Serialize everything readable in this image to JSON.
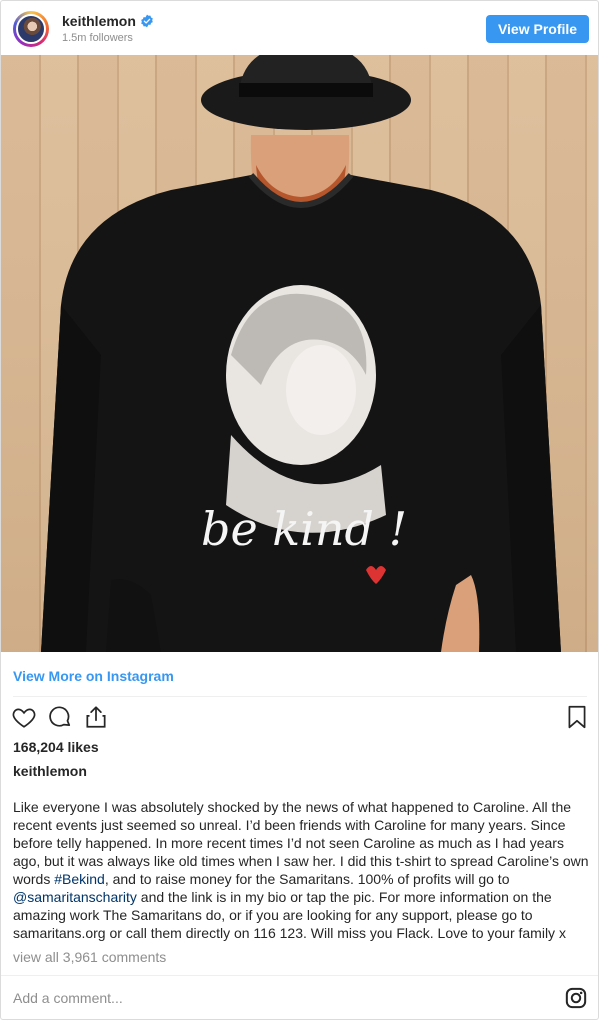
{
  "header": {
    "username": "keithlemon",
    "followers": "1.5m followers",
    "view_profile": "View Profile"
  },
  "post": {
    "image_text": "be kind !",
    "view_more": "View More on Instagram",
    "likes": "168,204 likes",
    "caption_user": "keithlemon",
    "caption_part1": "Like everyone I was absolutely shocked by the news of what happened to Caroline. All the recent events just seemed so unreal. I’d been friends with Caroline for many years. Since before telly happened. In more recent times I’d not seen Caroline as much as I had years ago, but it was always like old times when I saw her. I did this t-shirt to spread Caroline’s own words ",
    "hashtag": "#Bekind",
    "caption_part2": ", and to raise money for the Samaritans. 100% of profits will go to ",
    "mention": "@samaritanscharity",
    "caption_part3": " and the link is in my bio or tap the pic. For more information on the amazing work The Samaritans do, or if you are looking for any support, please go to samaritans.org or call them directly on 116 123. Will miss you Flack. Love to your family x",
    "view_comments": "view all 3,961 comments",
    "add_comment_placeholder": "Add a comment..."
  },
  "icons": {
    "like": "heart-icon",
    "comment": "comment-icon",
    "share": "share-icon",
    "save": "bookmark-icon",
    "verified": "verified-badge-icon",
    "instagram": "instagram-logo-icon"
  },
  "colors": {
    "accent": "#3897f0",
    "link": "#003569",
    "muted": "#8e8e8e"
  }
}
